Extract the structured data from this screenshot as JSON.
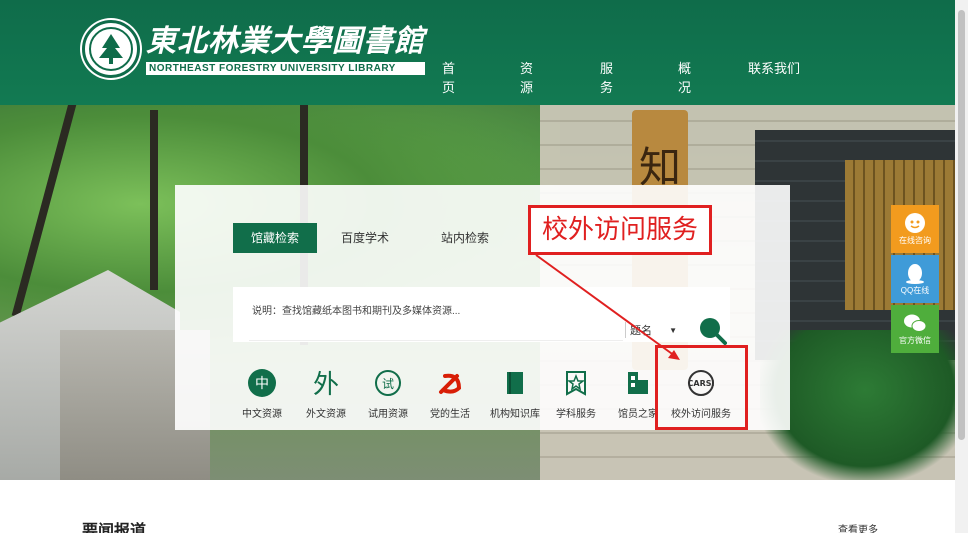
{
  "header": {
    "logo_cn": "東北林業大學圖書館",
    "logo_en": "NORTHEAST FORESTRY UNIVERSITY LIBRARY",
    "nav": [
      "首页",
      "资源",
      "服务",
      "概况",
      "联系我们"
    ]
  },
  "scene": {
    "wood_sign_char": "知"
  },
  "search": {
    "tabs": [
      "馆藏检索",
      "百度学术",
      "站内检索"
    ],
    "active_tab": "馆藏检索",
    "hint": "说明：查找馆藏纸本图书和期刊及多媒体资源...",
    "input_value": "",
    "select_value": "题名"
  },
  "quick_links": [
    {
      "label": "中文资源",
      "icon": "zhong-icon"
    },
    {
      "label": "外文资源",
      "icon": "wai-icon"
    },
    {
      "label": "试用资源",
      "icon": "shi-icon"
    },
    {
      "label": "党的生活",
      "icon": "party-emblem-icon"
    },
    {
      "label": "机构知识库",
      "icon": "book-icon"
    },
    {
      "label": "学科服务",
      "icon": "star-badge-icon"
    },
    {
      "label": "馆员之家",
      "icon": "building-icon"
    },
    {
      "label": "校外访问服务",
      "icon": "carsi-icon"
    }
  ],
  "annotation": {
    "label": "校外访问服务"
  },
  "side": [
    {
      "label": "在线咨询",
      "icon": "chat-bot-icon",
      "color": "#f29b1e"
    },
    {
      "label": "QQ在线",
      "icon": "qq-icon",
      "color": "#3f9bd8"
    },
    {
      "label": "官方微信",
      "icon": "wechat-icon",
      "color": "#4fae3c"
    }
  ],
  "news": {
    "title": "要闻报道",
    "more": "查看更多"
  },
  "colors": {
    "brand_green": "#0f6c4a",
    "annotation_red": "#e02020"
  }
}
